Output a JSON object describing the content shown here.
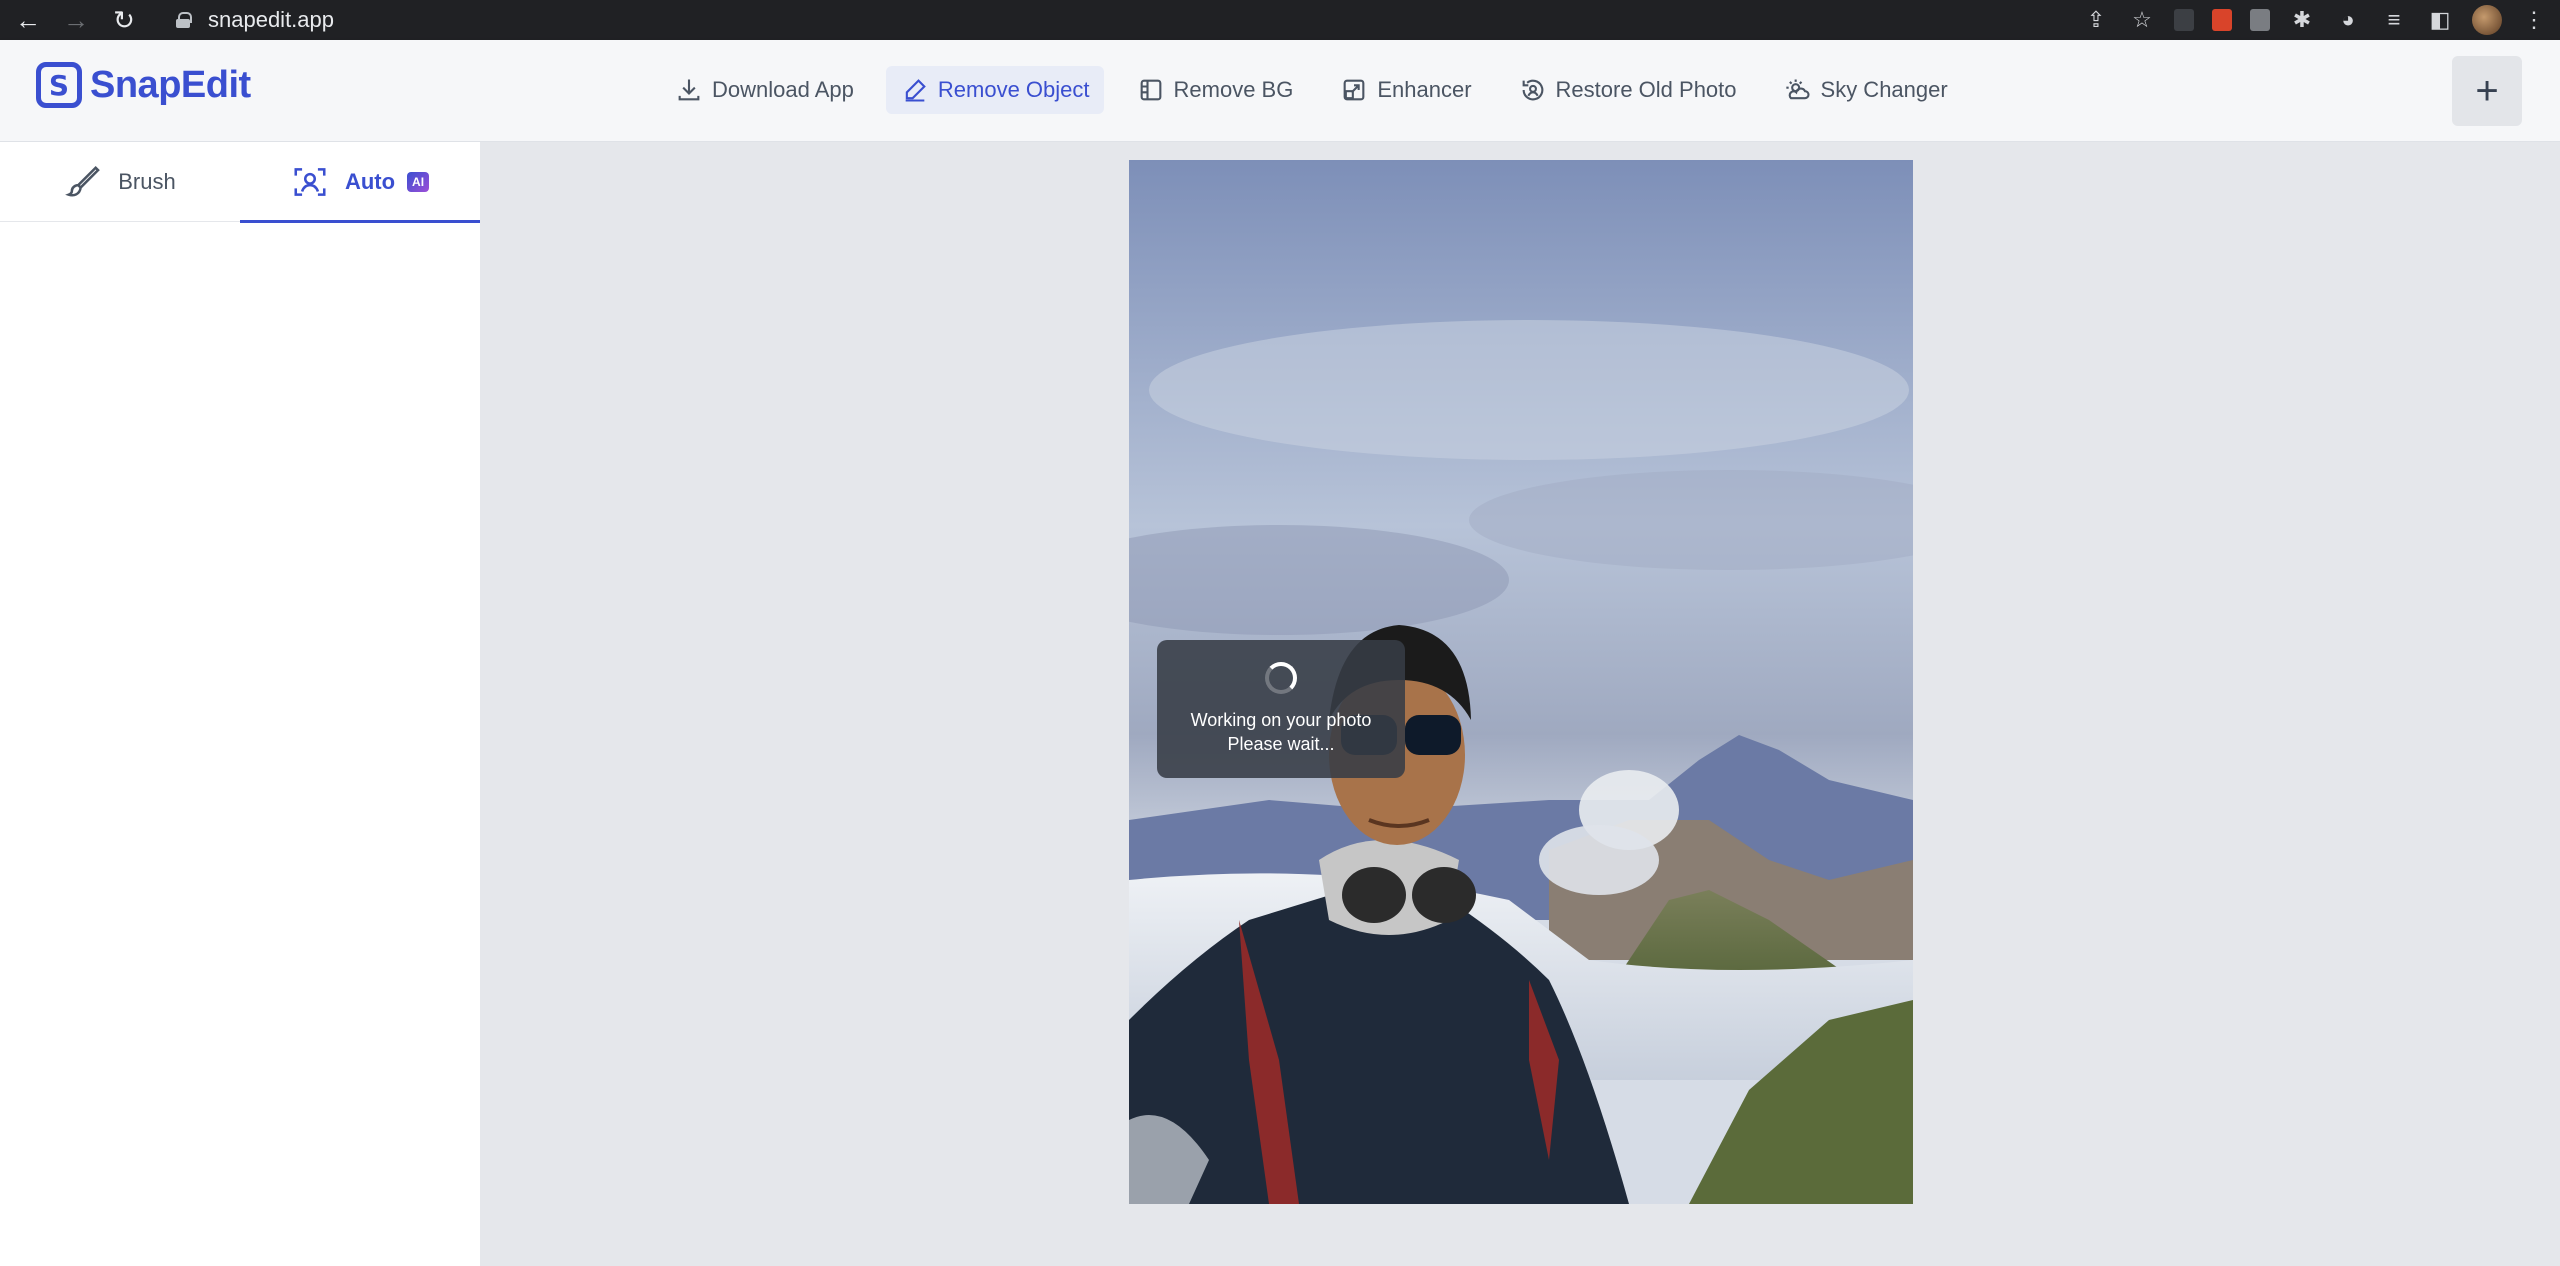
{
  "browser": {
    "url": "snapedit.app"
  },
  "brand": {
    "name": "SnapEdit"
  },
  "nav": {
    "items": [
      {
        "label": "Download App",
        "icon": "download-icon",
        "active": false
      },
      {
        "label": "Remove Object",
        "icon": "eraser-icon",
        "active": true
      },
      {
        "label": "Remove BG",
        "icon": "remove-bg-icon",
        "active": false
      },
      {
        "label": "Enhancer",
        "icon": "enhance-icon",
        "active": false
      },
      {
        "label": "Restore Old Photo",
        "icon": "restore-icon",
        "active": false
      },
      {
        "label": "Sky Changer",
        "icon": "sky-icon",
        "active": false
      }
    ],
    "plus_symbol": "+"
  },
  "left_panel": {
    "tabs": [
      {
        "label": "Brush",
        "icon": "brush-icon",
        "active": false
      },
      {
        "label": "Auto",
        "icon": "auto-detect-icon",
        "active": true,
        "badge": "AI"
      }
    ]
  },
  "loading": {
    "line1": "Working on your photo",
    "line2": "Please wait..."
  },
  "colors": {
    "accent": "#3a4fd0",
    "header_bg": "#f6f7f9",
    "canvas_bg": "#e5e7eb"
  }
}
